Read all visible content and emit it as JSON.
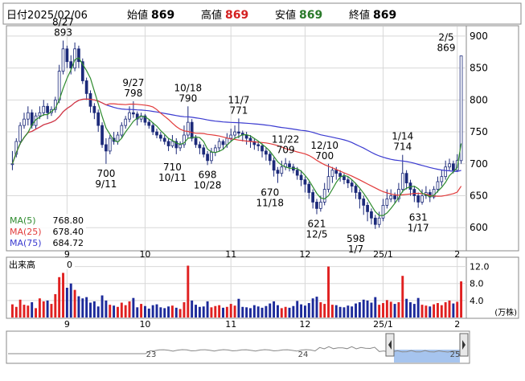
{
  "header": {
    "date_label": "日付",
    "date": "2025/02/06",
    "open_label": "始値",
    "open": "869",
    "high_label": "高値",
    "high": "869",
    "low_label": "安値",
    "low": "869",
    "close_label": "終値",
    "close": "869"
  },
  "colors": {
    "bg": "#ffffff",
    "grid": "#d8d8d8",
    "frame": "#888888",
    "candle_up": "#ffffff",
    "candle_down": "#1c2a7a",
    "candle_line": "#1c2a7a",
    "ma5": "#2e8b2e",
    "ma25": "#e23b3b",
    "ma75": "#3a3ad0",
    "vol_up": "#e02020",
    "vol_down": "#1c2a9a",
    "open_text": "#000000",
    "high_text": "#d42020",
    "low_text": "#2a7a2a",
    "close_text": "#000000",
    "navigator_fill": "#a6c4ee",
    "navigator_line": "#888888"
  },
  "legend": {
    "ma5_label": "MA(5)",
    "ma5_value": "768.80",
    "ma25_label": "MA(25)",
    "ma25_value": "678.40",
    "ma75_label": "MA(75)",
    "ma75_value": "684.72"
  },
  "volume_panel": {
    "title": "出来高",
    "current": "0",
    "unit": "(万株)"
  },
  "navigator": {
    "labels": [
      "23",
      "24",
      "25"
    ]
  },
  "chart_data": {
    "type": "candlestick",
    "price_axis": {
      "ylim": [
        565,
        915
      ],
      "ticks": [
        600,
        650,
        700,
        750,
        800,
        850,
        900
      ]
    },
    "volume_axis": {
      "ylim": [
        0,
        14
      ],
      "ticks": [
        "4.0",
        "8.0",
        "12.0"
      ]
    },
    "x_ticks": [
      "9",
      "10",
      "11",
      "12",
      "25/1",
      "2"
    ],
    "annotations": [
      {
        "date": "8/27",
        "price": "893",
        "kind": "high"
      },
      {
        "date": "9/27",
        "price": "798",
        "kind": "high"
      },
      {
        "date": "10/18",
        "price": "790",
        "kind": "high"
      },
      {
        "date": "11/7",
        "price": "771",
        "kind": "high"
      },
      {
        "date": "11/22",
        "price": "709",
        "kind": "high"
      },
      {
        "date": "12/10",
        "price": "700",
        "kind": "high"
      },
      {
        "date": "1/14",
        "price": "714",
        "kind": "high"
      },
      {
        "date": "2/5",
        "price": "869",
        "kind": "high"
      },
      {
        "date": "9/11",
        "price": "700",
        "kind": "low"
      },
      {
        "date": "10/11",
        "price": "710",
        "kind": "low"
      },
      {
        "date": "10/28",
        "price": "698",
        "kind": "low"
      },
      {
        "date": "11/18",
        "price": "670",
        "kind": "low"
      },
      {
        "date": "12/5",
        "price": "621",
        "kind": "low"
      },
      {
        "date": "1/7",
        "price": "598",
        "kind": "low"
      },
      {
        "date": "1/17",
        "price": "631",
        "kind": "low"
      }
    ],
    "candles": [
      [
        700,
        700,
        720,
        690
      ],
      [
        715,
        735,
        740,
        710
      ],
      [
        735,
        760,
        765,
        730
      ],
      [
        760,
        770,
        780,
        755
      ],
      [
        770,
        780,
        790,
        760
      ],
      [
        780,
        760,
        785,
        755
      ],
      [
        760,
        775,
        780,
        755
      ],
      [
        775,
        780,
        790,
        770
      ],
      [
        780,
        790,
        800,
        775
      ],
      [
        790,
        780,
        795,
        770
      ],
      [
        780,
        785,
        790,
        775
      ],
      [
        785,
        800,
        805,
        780
      ],
      [
        800,
        845,
        855,
        795
      ],
      [
        845,
        880,
        893,
        840
      ],
      [
        880,
        860,
        885,
        850
      ],
      [
        860,
        850,
        870,
        840
      ],
      [
        850,
        880,
        890,
        845
      ],
      [
        880,
        860,
        885,
        850
      ],
      [
        860,
        830,
        865,
        825
      ],
      [
        830,
        810,
        835,
        800
      ],
      [
        810,
        790,
        815,
        780
      ],
      [
        790,
        780,
        795,
        770
      ],
      [
        780,
        760,
        785,
        750
      ],
      [
        760,
        730,
        765,
        725
      ],
      [
        730,
        720,
        740,
        700
      ],
      [
        720,
        740,
        745,
        715
      ],
      [
        740,
        735,
        750,
        730
      ],
      [
        735,
        745,
        750,
        730
      ],
      [
        745,
        760,
        765,
        740
      ],
      [
        760,
        770,
        775,
        755
      ],
      [
        770,
        780,
        790,
        765
      ],
      [
        780,
        778,
        798,
        772
      ],
      [
        778,
        770,
        782,
        760
      ],
      [
        770,
        775,
        780,
        765
      ],
      [
        775,
        765,
        778,
        760
      ],
      [
        765,
        760,
        770,
        755
      ],
      [
        760,
        750,
        765,
        745
      ],
      [
        750,
        745,
        755,
        740
      ],
      [
        745,
        740,
        750,
        735
      ],
      [
        740,
        735,
        745,
        730
      ],
      [
        735,
        728,
        740,
        720
      ],
      [
        728,
        735,
        745,
        725
      ],
      [
        735,
        725,
        740,
        715
      ],
      [
        725,
        730,
        735,
        720
      ],
      [
        730,
        745,
        760,
        725
      ],
      [
        745,
        765,
        790,
        740
      ],
      [
        765,
        740,
        770,
        735
      ],
      [
        740,
        730,
        745,
        725
      ],
      [
        730,
        725,
        735,
        715
      ],
      [
        725,
        715,
        730,
        710
      ],
      [
        715,
        705,
        720,
        698
      ],
      [
        705,
        718,
        725,
        700
      ],
      [
        718,
        725,
        730,
        712
      ],
      [
        725,
        735,
        740,
        720
      ],
      [
        735,
        730,
        738,
        722
      ],
      [
        730,
        740,
        748,
        725
      ],
      [
        740,
        745,
        755,
        735
      ],
      [
        745,
        750,
        760,
        740
      ],
      [
        750,
        748,
        771,
        740
      ],
      [
        748,
        745,
        752,
        735
      ],
      [
        745,
        740,
        750,
        730
      ],
      [
        740,
        735,
        745,
        725
      ],
      [
        735,
        730,
        740,
        722
      ],
      [
        730,
        728,
        735,
        720
      ],
      [
        728,
        720,
        732,
        710
      ],
      [
        720,
        715,
        725,
        705
      ],
      [
        715,
        705,
        720,
        698
      ],
      [
        705,
        690,
        710,
        680
      ],
      [
        690,
        685,
        695,
        670
      ],
      [
        685,
        695,
        705,
        680
      ],
      [
        695,
        700,
        709,
        690
      ],
      [
        700,
        695,
        705,
        688
      ],
      [
        695,
        690,
        700,
        685
      ],
      [
        690,
        682,
        695,
        675
      ],
      [
        682,
        675,
        690,
        665
      ],
      [
        675,
        668,
        680,
        655
      ],
      [
        668,
        655,
        672,
        645
      ],
      [
        655,
        640,
        660,
        630
      ],
      [
        640,
        630,
        645,
        621
      ],
      [
        630,
        640,
        650,
        625
      ],
      [
        640,
        660,
        670,
        635
      ],
      [
        660,
        680,
        700,
        655
      ],
      [
        680,
        690,
        695,
        670
      ],
      [
        690,
        685,
        695,
        675
      ],
      [
        685,
        680,
        690,
        672
      ],
      [
        680,
        675,
        685,
        668
      ],
      [
        675,
        670,
        680,
        662
      ],
      [
        670,
        665,
        675,
        655
      ],
      [
        665,
        655,
        670,
        645
      ],
      [
        655,
        645,
        660,
        630
      ],
      [
        645,
        635,
        650,
        620
      ],
      [
        635,
        625,
        640,
        610
      ],
      [
        625,
        615,
        630,
        605
      ],
      [
        615,
        605,
        620,
        598
      ],
      [
        605,
        615,
        625,
        600
      ],
      [
        615,
        635,
        645,
        610
      ],
      [
        635,
        645,
        660,
        630
      ],
      [
        645,
        650,
        660,
        640
      ],
      [
        650,
        645,
        655,
        638
      ],
      [
        645,
        660,
        670,
        640
      ],
      [
        660,
        685,
        714,
        655
      ],
      [
        685,
        670,
        690,
        660
      ],
      [
        670,
        660,
        675,
        650
      ],
      [
        660,
        650,
        665,
        640
      ],
      [
        650,
        640,
        655,
        631
      ],
      [
        640,
        650,
        660,
        636
      ],
      [
        650,
        655,
        665,
        645
      ],
      [
        655,
        648,
        660,
        640
      ],
      [
        648,
        660,
        665,
        645
      ],
      [
        660,
        672,
        680,
        655
      ],
      [
        672,
        680,
        690,
        665
      ],
      [
        680,
        695,
        705,
        675
      ],
      [
        695,
        700,
        708,
        690
      ],
      [
        700,
        690,
        705,
        685
      ],
      [
        690,
        705,
        715,
        688
      ],
      [
        705,
        869,
        869,
        700
      ]
    ],
    "volume": [
      3.1,
      2.5,
      4.2,
      3.0,
      2.8,
      3.6,
      2.2,
      4.5,
      3.8,
      4.0,
      3.2,
      5.5,
      9.5,
      10.5,
      7.0,
      8.0,
      6.5,
      5.0,
      4.5,
      4.8,
      3.5,
      3.8,
      2.6,
      5.2,
      4.0,
      3.0,
      2.8,
      2.5,
      3.5,
      2.9,
      3.8,
      4.6,
      2.4,
      3.2,
      2.7,
      2.1,
      2.9,
      3.1,
      2.4,
      2.2,
      2.6,
      2.8,
      2.3,
      2.0,
      3.6,
      12.2,
      4.0,
      3.0,
      2.5,
      2.6,
      3.8,
      2.4,
      2.7,
      2.9,
      2.3,
      2.5,
      3.2,
      2.8,
      4.4,
      2.5,
      2.4,
      2.2,
      2.9,
      2.6,
      2.3,
      2.7,
      3.3,
      3.8,
      2.9,
      2.2,
      2.5,
      2.3,
      2.7,
      3.9,
      3.1,
      2.8,
      3.4,
      4.5,
      4.9,
      3.6,
      3.2,
      12.0,
      3.0,
      2.9,
      2.5,
      2.4,
      2.8,
      2.6,
      3.3,
      3.6,
      4.2,
      4.0,
      3.5,
      4.8,
      3.0,
      3.4,
      4.1,
      3.7,
      3.2,
      3.6,
      9.8,
      4.4,
      3.6,
      3.2,
      4.6,
      3.0,
      2.8,
      2.6,
      3.1,
      3.4,
      2.9,
      3.6,
      4.0,
      3.3,
      3.7,
      8.5
    ]
  }
}
